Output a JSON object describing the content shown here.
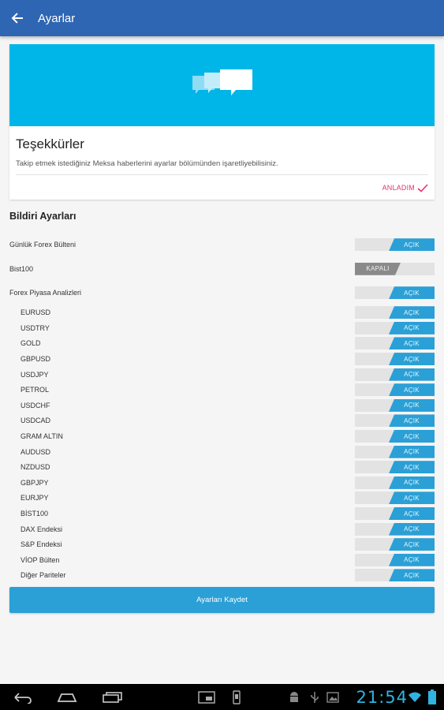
{
  "appbar": {
    "title": "Ayarlar",
    "back_icon": "arrow-back-icon"
  },
  "welcome_card": {
    "hero_icon": "chat-bubbles-icon",
    "hero_color": "#00b6e8",
    "title": "Teşekkürler",
    "text": "Takip etmek istediğiniz Meksa haberlerini ayarlar bölümünden işaretliyebilisiniz.",
    "ack_label": "ANLADIM",
    "ack_color": "#e8336b"
  },
  "notifications": {
    "title": "Bildiri Ayarları",
    "on_label": "AÇIK",
    "off_label": "KAPALI",
    "groups": [
      {
        "label": "Günlük Forex Bülteni",
        "on": true,
        "sub": []
      },
      {
        "label": "Bist100",
        "on": false,
        "sub": []
      },
      {
        "label": "Forex Piyasa Analizleri",
        "on": true,
        "sub": [
          {
            "label": "EURUSD",
            "on": true
          },
          {
            "label": "USDTRY",
            "on": true
          },
          {
            "label": "GOLD",
            "on": true
          },
          {
            "label": "GBPUSD",
            "on": true
          },
          {
            "label": "USDJPY",
            "on": true
          },
          {
            "label": "PETROL",
            "on": true
          },
          {
            "label": "USDCHF",
            "on": true
          },
          {
            "label": "USDCAD",
            "on": true
          },
          {
            "label": "GRAM ALTIN",
            "on": true
          },
          {
            "label": "AUDUSD",
            "on": true
          },
          {
            "label": "NZDUSD",
            "on": true
          },
          {
            "label": "GBPJPY",
            "on": true
          },
          {
            "label": "EURJPY",
            "on": true
          },
          {
            "label": "BİST100",
            "on": true
          },
          {
            "label": "DAX Endeksi",
            "on": true
          },
          {
            "label": "S&P Endeksi",
            "on": true
          },
          {
            "label": "VİOP Bülten",
            "on": true
          },
          {
            "label": "Diğer Pariteler",
            "on": true
          }
        ]
      }
    ]
  },
  "save_button": {
    "label": "Ayarları Kaydet"
  },
  "system_bar": {
    "time": "21:54"
  },
  "colors": {
    "primary": "#2f66b3",
    "accent": "#2aa0d6",
    "off": "#8a8a8a"
  }
}
